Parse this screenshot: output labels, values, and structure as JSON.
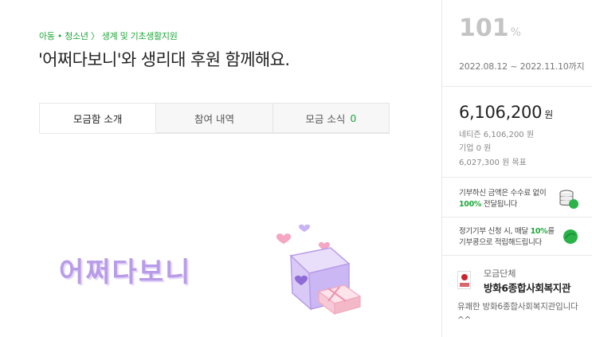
{
  "header": {
    "category": "아동 • 청소년 〉 생계 및 기초생활지원",
    "title": "'어쩌다보니'와 생리대 후원 함께해요."
  },
  "tabs": [
    {
      "label": "모금함 소개",
      "active": true
    },
    {
      "label": "참여 내역",
      "active": false
    },
    {
      "label": "모금 소식",
      "count": "0",
      "active": false
    }
  ],
  "hero": {
    "text": "어쩌다보니",
    "colors": {
      "text": "#b99ce8",
      "box": "#d9c9f7",
      "heart": "#f4a6c3",
      "gift": "#f7c9d6"
    }
  },
  "summary": {
    "percent": "101",
    "percent_unit": "%",
    "period": "2022.08.12 ~ 2022.11.10까지",
    "amount": "6,106,200",
    "amount_unit": "원",
    "netizen": "네티즌 6,106,200 원",
    "company": "기업 0 원",
    "goal": "6,027,300 원 목표"
  },
  "notices": {
    "fee_pre": "기부하신 금액은 수수료 없이",
    "fee_hl": "100%",
    "fee_post": " 전달됩니다",
    "fee_icon": "coin-stack-icon",
    "bean_pre": "정기기부 신청 시, 매달 ",
    "bean_hl": "10%",
    "bean_post": "를",
    "bean_line2": "기부콩으로 적립해드립니다",
    "bean_icon": "green-bean-icon"
  },
  "organization": {
    "label": "모금단체",
    "name": "방화6종합사회복지관",
    "description": "유쾌한 방화6종합사회복지관입니다^^"
  },
  "colors": {
    "accent": "#1fa83a",
    "muted": "#c4c4c4"
  }
}
